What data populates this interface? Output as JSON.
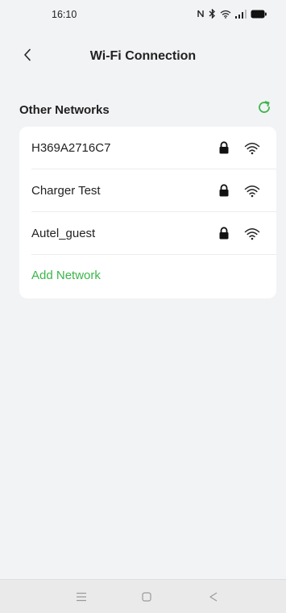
{
  "status_bar": {
    "time": "16:10",
    "icons": [
      "nfc-icon",
      "bluetooth-icon",
      "wifi-status-icon",
      "signal-icon",
      "battery-icon"
    ]
  },
  "header": {
    "title": "Wi-Fi Connection",
    "back_icon": "chevron-left-icon"
  },
  "section": {
    "title": "Other Networks",
    "refresh_icon": "refresh-icon"
  },
  "networks": [
    {
      "name": "H369A2716C7",
      "secured": true,
      "signal": "full"
    },
    {
      "name": "Charger Test",
      "secured": true,
      "signal": "full"
    },
    {
      "name": "Autel_guest",
      "secured": true,
      "signal": "full"
    }
  ],
  "add_network_label": "Add Network",
  "colors": {
    "accent_green": "#3bb54a",
    "background": "#f2f3f5",
    "card": "#ffffff"
  },
  "nav_bar": {
    "icons": [
      "menu-icon",
      "home-icon",
      "back-triangle-icon"
    ]
  }
}
